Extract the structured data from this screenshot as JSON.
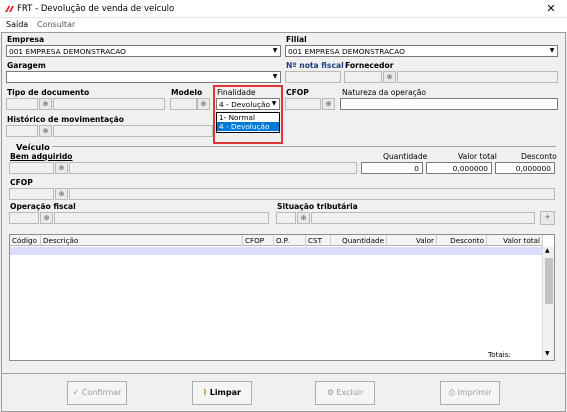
{
  "window": {
    "title": "FRT - Devolução de venda de veículo"
  },
  "menu": {
    "items": [
      "Saída",
      "Consultar"
    ]
  },
  "empresa": {
    "label": "Empresa",
    "value": "001 EMPRESA DEMONSTRACAO"
  },
  "filial": {
    "label": "Filial",
    "value": "001 EMPRESA DEMONSTRACAO"
  },
  "garagem": {
    "label": "Garagem",
    "value": ""
  },
  "nota_fiscal": {
    "label": "Nº nota fiscal",
    "value": ""
  },
  "fornecedor": {
    "label": "Fornecedor",
    "value": ""
  },
  "tipo_documento": {
    "label": "Tipo de documento",
    "value": ""
  },
  "modelo": {
    "label": "Modelo",
    "value": ""
  },
  "finalidade": {
    "label": "Finalidade",
    "value": "4 - Devolução",
    "options": [
      "1- Normal",
      "4 - Devolução"
    ],
    "selected_index": 1
  },
  "cfop_top": {
    "label": "CFOP",
    "value": ""
  },
  "natureza": {
    "label": "Natureza da operação",
    "value": ""
  },
  "historico": {
    "label": "Histórico de movimentação",
    "value": ""
  },
  "veiculo": {
    "section_label": "Veículo",
    "bem_label": "Bem adquirido",
    "quantidade_label": "Quantidade",
    "quantidade_value": "0",
    "valor_total_label": "Valor total",
    "valor_total_value": "0,000000",
    "desconto_label": "Desconto",
    "desconto_value": "0,000000",
    "cfop_label": "CFOP",
    "operacao_label": "Operação fiscal",
    "situacao_label": "Situação tributária"
  },
  "grid": {
    "columns": [
      "Código",
      "Descrição",
      "CFOP",
      "O.P.",
      "CST",
      "Quantidade",
      "Valor",
      "Desconto",
      "Valor total"
    ],
    "totals_label": "Totais:"
  },
  "buttons": {
    "confirmar": "Confirmar",
    "limpar": "Limpar",
    "excluir": "Excluir",
    "imprimir": "Imprimir"
  },
  "colors": {
    "highlight": "#e0353a",
    "selection": "#0078d7",
    "label_blue": "#1f3c88"
  }
}
